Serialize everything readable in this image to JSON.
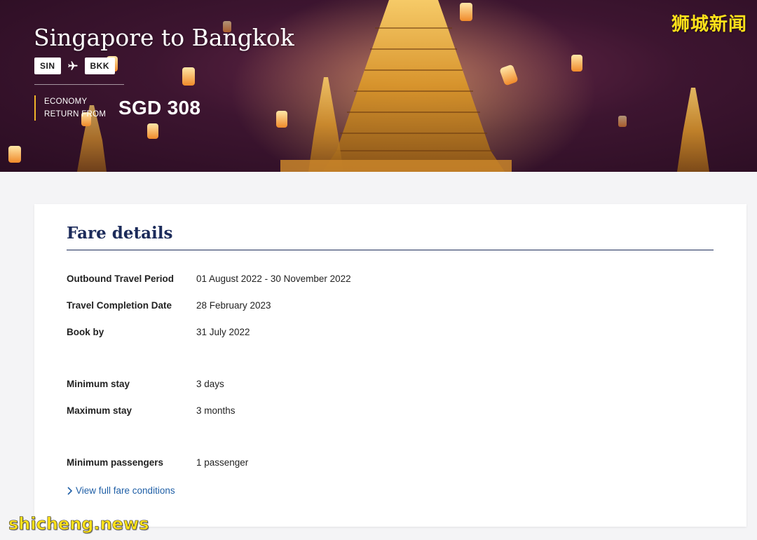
{
  "watermarks": {
    "top": "狮城新闻",
    "bottom": "shicheng.news"
  },
  "hero": {
    "title": "Singapore to Bangkok",
    "origin_code": "SIN",
    "destination_code": "BKK",
    "cabin_label": "ECONOMY",
    "trip_label": "RETURN FROM",
    "price": "SGD 308"
  },
  "fare_details": {
    "title": "Fare details",
    "rows": [
      {
        "label": "Outbound Travel Period",
        "value": "01 August 2022 - 30 November 2022"
      },
      {
        "label": "Travel Completion Date",
        "value": "28 February 2023"
      },
      {
        "label": "Book by",
        "value": "31 July 2022"
      },
      {
        "label": "Minimum stay",
        "value": "3 days"
      },
      {
        "label": "Maximum stay",
        "value": "3 months"
      },
      {
        "label": "Minimum passengers",
        "value": "1 passenger"
      }
    ],
    "link_label": "View full fare conditions"
  },
  "colors": {
    "accent": "#f0b429",
    "heading": "#1c2b5a",
    "link": "#1f5fa6"
  }
}
